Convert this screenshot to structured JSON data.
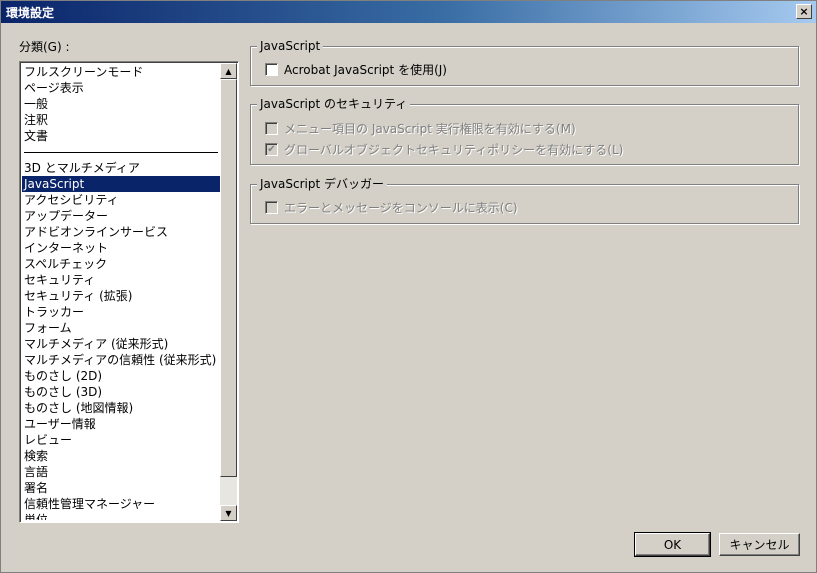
{
  "window": {
    "title": "環境設定",
    "close_glyph": "×"
  },
  "categories": {
    "label": "分類(G) :",
    "group_a": [
      "フルスクリーンモード",
      "ページ表示",
      "一般",
      "注釈",
      "文書"
    ],
    "group_b": [
      "3D とマルチメディア",
      "JavaScript",
      "アクセシビリティ",
      "アップデーター",
      "アドビオンラインサービス",
      "インターネット",
      "スペルチェック",
      "セキュリティ",
      "セキュリティ (拡張)",
      "トラッカー",
      "フォーム",
      "マルチメディア (従来形式)",
      "マルチメディアの信頼性 (従来形式)",
      "ものさし (2D)",
      "ものさし (3D)",
      "ものさし (地図情報)",
      "ユーザー情報",
      "レビュー",
      "検索",
      "言語",
      "署名",
      "信頼性管理マネージャー",
      "単位"
    ],
    "selected": "JavaScript"
  },
  "groups": {
    "javascript": {
      "title": "JavaScript",
      "enable": {
        "label": "Acrobat JavaScript を使用(J)",
        "checked": false
      }
    },
    "security": {
      "title": "JavaScript のセキュリティ",
      "menu_privileges": {
        "label": "メニュー項目の JavaScript 実行権限を有効にする(M)",
        "checked": false
      },
      "global_object": {
        "label": "グローバルオブジェクトセキュリティポリシーを有効にする(L)",
        "checked": true
      }
    },
    "debugger": {
      "title": "JavaScript デバッガー",
      "console": {
        "label": "エラーとメッセージをコンソールに表示(C)",
        "checked": false
      }
    }
  },
  "buttons": {
    "ok": "OK",
    "cancel": "キャンセル"
  },
  "icons": {
    "check": "✔",
    "up": "▲",
    "down": "▼"
  }
}
